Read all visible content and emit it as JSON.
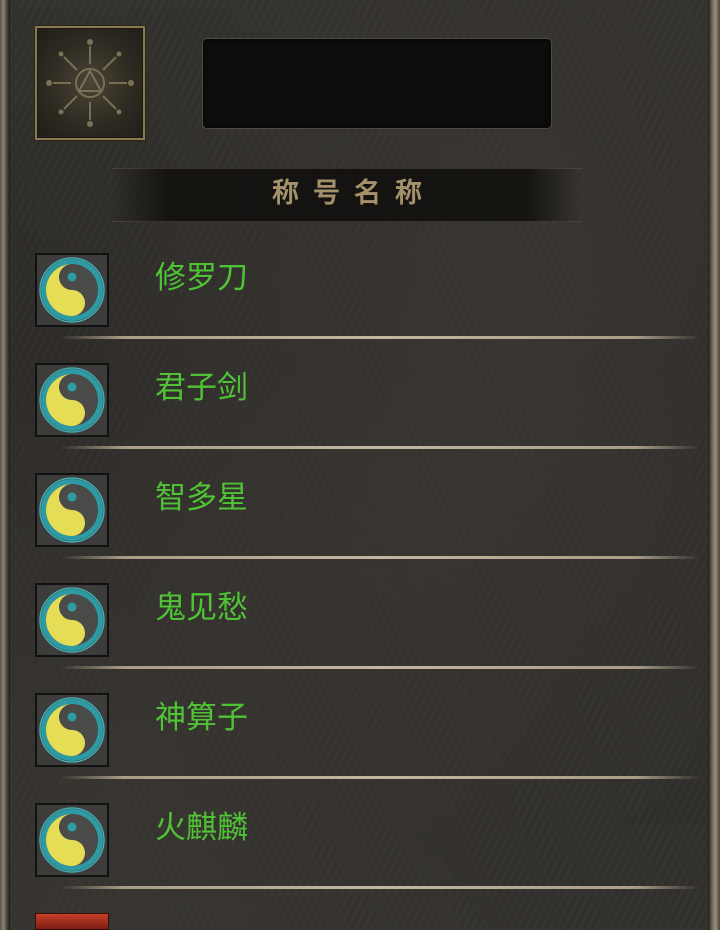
{
  "header": {
    "title": "称号名称",
    "name_value": ""
  },
  "titles": [
    {
      "label": "修罗刀",
      "icon": "yin-yang-icon"
    },
    {
      "label": "君子剑",
      "icon": "yin-yang-icon"
    },
    {
      "label": "智多星",
      "icon": "yin-yang-icon"
    },
    {
      "label": "鬼见愁",
      "icon": "yin-yang-icon"
    },
    {
      "label": "神算子",
      "icon": "yin-yang-icon"
    },
    {
      "label": "火麒麟",
      "icon": "yin-yang-icon"
    }
  ],
  "colors": {
    "title_green": "#4fc335",
    "header_gold": "#a4916a",
    "panel_dark": "#2c2a27"
  }
}
